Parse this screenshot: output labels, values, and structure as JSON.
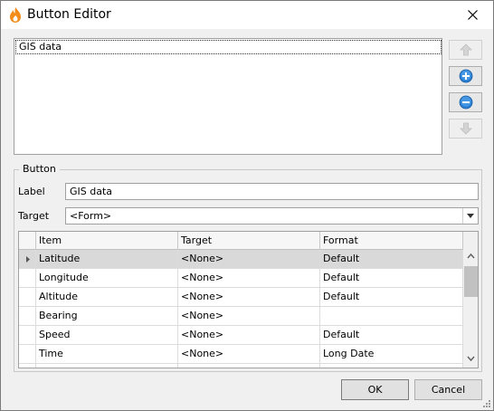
{
  "window": {
    "title": "Button Editor"
  },
  "buttons_list": {
    "items": [
      "GIS data"
    ]
  },
  "group": {
    "title": "Button",
    "label_caption": "Label",
    "label_value": "GIS data",
    "target_caption": "Target",
    "target_value": "<Form>"
  },
  "grid": {
    "columns": [
      "Item",
      "Target",
      "Format"
    ],
    "rows": [
      {
        "item": "Latitude",
        "target": "<None>",
        "format": "Default"
      },
      {
        "item": "Longitude",
        "target": "<None>",
        "format": "Default"
      },
      {
        "item": "Altitude",
        "target": "<None>",
        "format": "Default"
      },
      {
        "item": "Bearing",
        "target": "<None>",
        "format": ""
      },
      {
        "item": "Speed",
        "target": "<None>",
        "format": "Default"
      },
      {
        "item": "Time",
        "target": "<None>",
        "format": "Long Date"
      }
    ]
  },
  "footer": {
    "ok_label": "OK",
    "cancel_label": "Cancel"
  },
  "icons": {
    "app": "flame-icon",
    "close": "close-icon",
    "up": "arrow-up-icon",
    "add": "plus-circle-icon",
    "remove": "minus-circle-icon",
    "down": "arrow-down-icon"
  },
  "colors": {
    "accent_blue": "#2a7fd4",
    "app_icon": "#f28c1a"
  }
}
